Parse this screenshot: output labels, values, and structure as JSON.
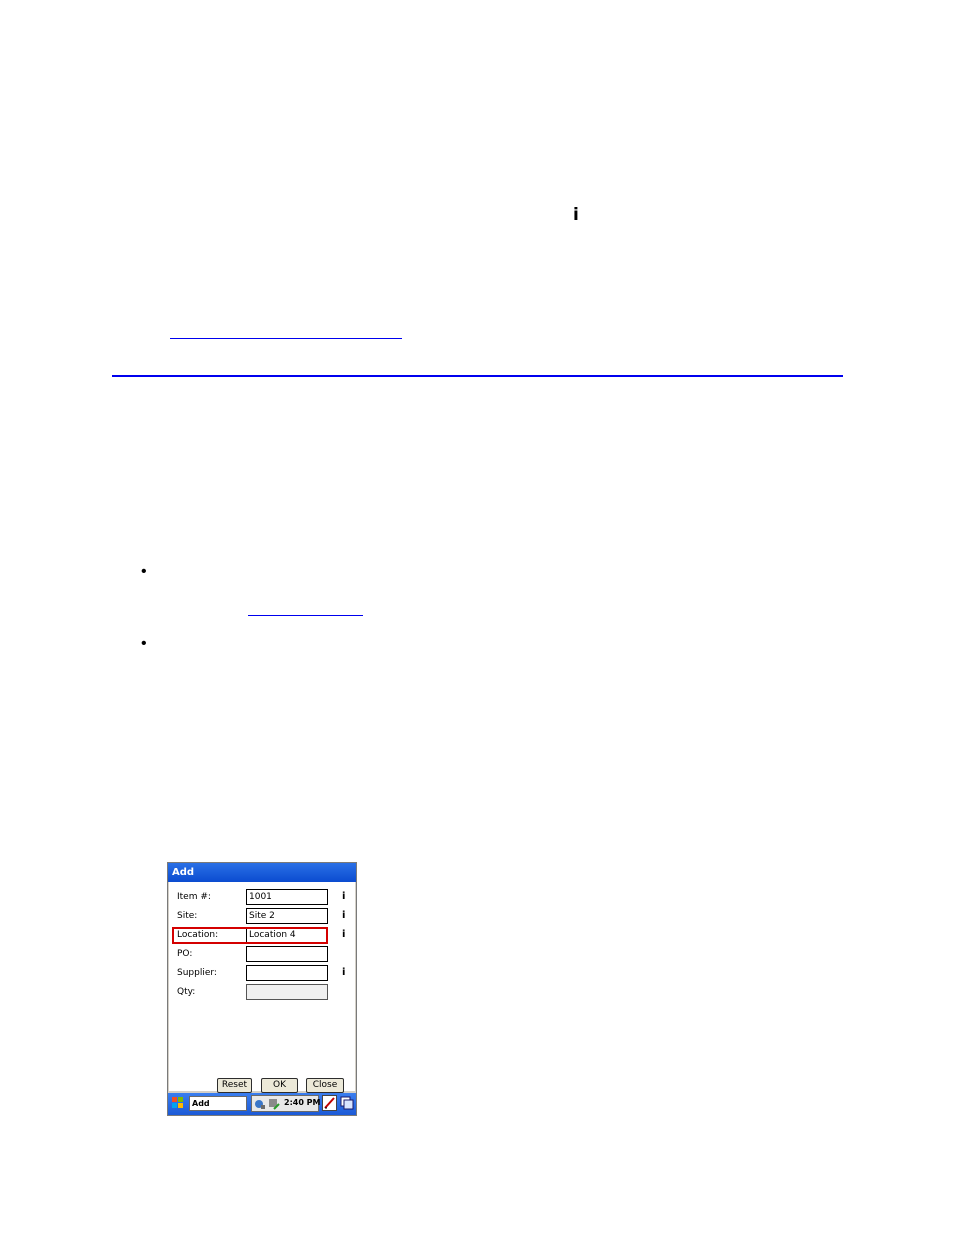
{
  "page": {
    "info_glyph": "i",
    "bullets": [
      "•",
      "•"
    ]
  },
  "dialog": {
    "title": "Add",
    "fields": [
      {
        "label": "Item #:",
        "value": "1001",
        "info": "i"
      },
      {
        "label": "Site:",
        "value": "Site 2",
        "info": "i"
      },
      {
        "label": "Location:",
        "value": "Location 4",
        "info": "i"
      },
      {
        "label": "PO:",
        "value": "",
        "info": ""
      },
      {
        "label": "Supplier:",
        "value": "",
        "info": "i"
      },
      {
        "label": "Qty:",
        "value": "",
        "info": ""
      }
    ],
    "buttons": {
      "reset": "Reset",
      "ok": "OK",
      "close": "Close"
    }
  },
  "taskbar": {
    "task_label": "Add",
    "clock": "2:40 PM",
    "start_icon": "windows-flag-icon",
    "tray_icons": [
      "network-connection-icon",
      "device-sync-icon"
    ],
    "input_icon": "keyboard-input-icon",
    "desktop_icon": "show-desktop-icon"
  },
  "colors": {
    "link_blue": "#0000ee",
    "title_bar": "#0b4bd0",
    "highlight_red": "#d40000"
  }
}
